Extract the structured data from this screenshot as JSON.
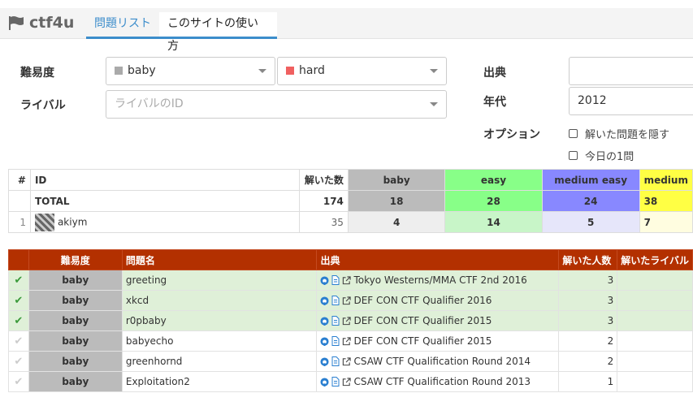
{
  "nav": {
    "brand": "ctf4u",
    "tabs": [
      {
        "label": "問題リスト"
      },
      {
        "label": "このサイトの使い方"
      }
    ]
  },
  "filters": {
    "difficulty_label": "難易度",
    "difficulty_min": {
      "value": "baby",
      "color": "#aaaaaa"
    },
    "difficulty_max": {
      "value": "hard",
      "color": "#f06060"
    },
    "rival_label": "ライバル",
    "rival_placeholder": "ライバルのID",
    "source_label": "出典",
    "source_value": "",
    "year_label": "年代",
    "year_value": "2012",
    "option_label": "オプション",
    "options": [
      {
        "label": "解いた問題を隠す",
        "checked": false
      },
      {
        "label": "今日の1問",
        "checked": false
      }
    ]
  },
  "ranking": {
    "headers": [
      "#",
      "ID",
      "解いた数",
      "baby",
      "easy",
      "medium easy",
      "medium"
    ],
    "header_colors": [
      "#bbbbbb",
      "#88ff88",
      "#8888ff",
      "#ffff44"
    ],
    "total": {
      "label": "TOTAL",
      "solved": "174",
      "counts": [
        "18",
        "28",
        "24",
        "38"
      ]
    },
    "users": [
      {
        "rank": "1",
        "id": "akiym",
        "solved": "35",
        "counts": [
          "4",
          "14",
          "5",
          "7"
        ]
      }
    ],
    "cell_colors": [
      "#eeeeee",
      "#c8f5c8",
      "#e6e6fa",
      "#fffde0"
    ]
  },
  "problems": {
    "headers": [
      "難易度",
      "問題名",
      "出典",
      "解いた人数",
      "解いたライバル"
    ],
    "rows": [
      {
        "solved": true,
        "difficulty": "baby",
        "name": "greeting",
        "source": "Tokyo Westerns/MMA CTF 2nd 2016",
        "count": "3"
      },
      {
        "solved": true,
        "difficulty": "baby",
        "name": "xkcd",
        "source": "DEF CON CTF Qualifier 2016",
        "count": "3"
      },
      {
        "solved": true,
        "difficulty": "baby",
        "name": "r0pbaby",
        "source": "DEF CON CTF Qualifier 2015",
        "count": "3"
      },
      {
        "solved": false,
        "difficulty": "baby",
        "name": "babyecho",
        "source": "DEF CON CTF Qualifier 2015",
        "count": "2"
      },
      {
        "solved": false,
        "difficulty": "baby",
        "name": "greenhornd",
        "source": "CSAW CTF Qualification Round 2014",
        "count": "2"
      },
      {
        "solved": false,
        "difficulty": "baby",
        "name": "Exploitation2",
        "source": "CSAW CTF Qualification Round 2013",
        "count": "1"
      }
    ]
  }
}
